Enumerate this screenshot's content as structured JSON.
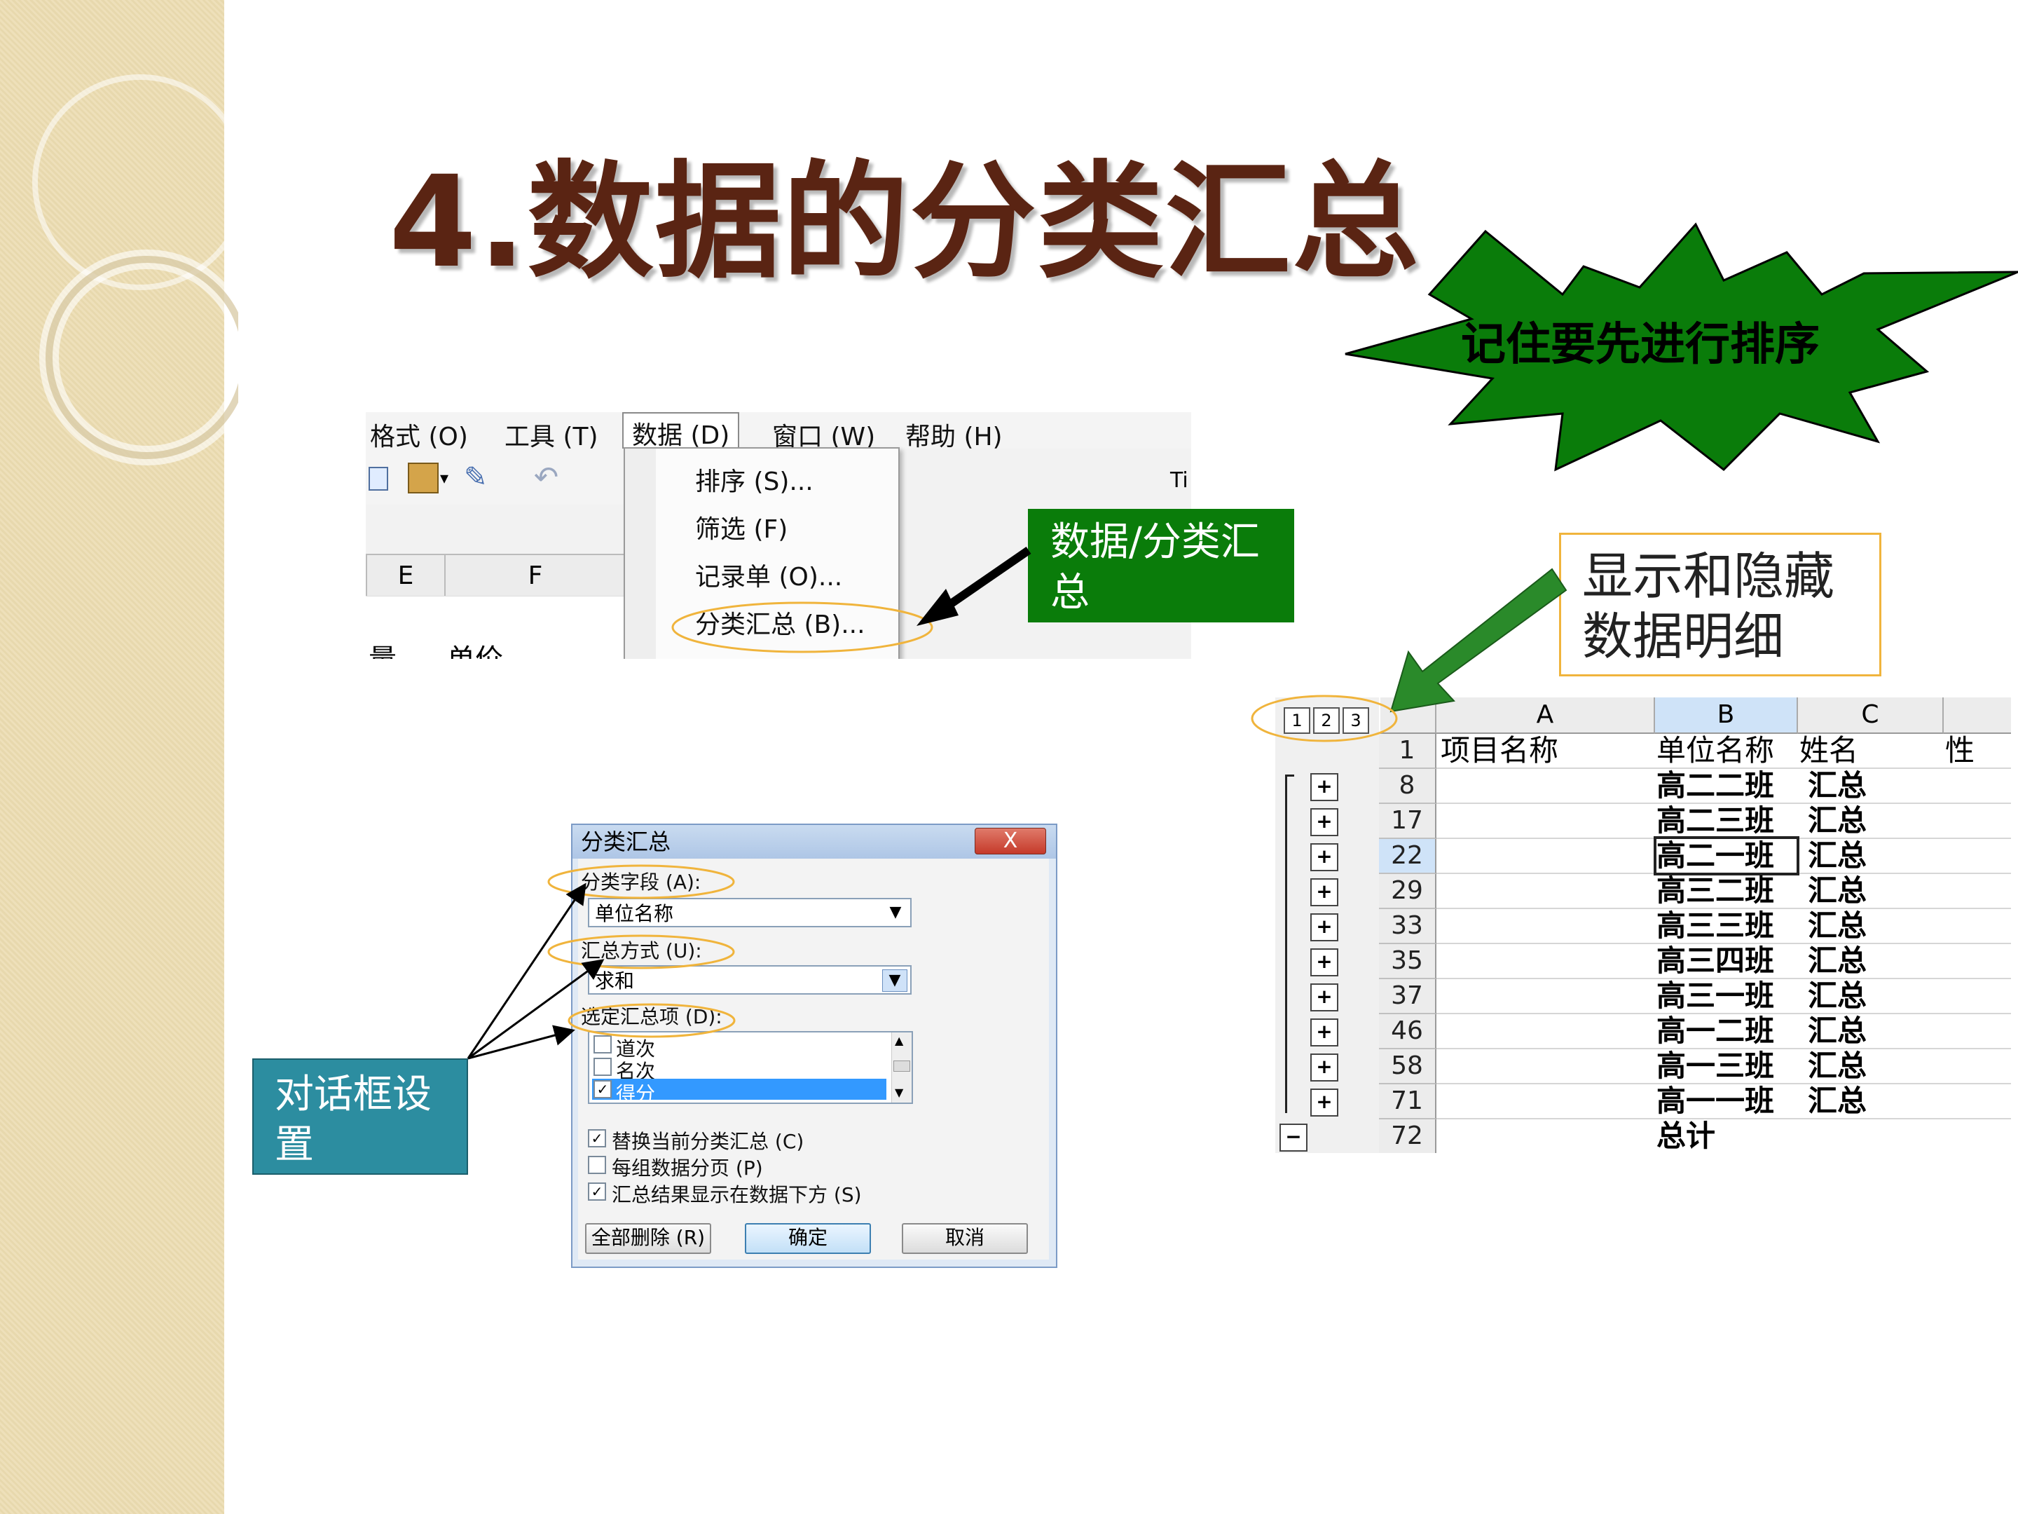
{
  "title": "4.数据的分类汇总",
  "starburst": {
    "text": "记住要先进行排序"
  },
  "menu": {
    "items": [
      "格式 (O)",
      "工具 (T)",
      "数据 (D)",
      "窗口 (W)",
      "帮助 (H)"
    ],
    "dropdown": [
      "排序 (S)...",
      "筛选 (F)",
      "记录单 (O)...",
      "分类汇总 (B)..."
    ],
    "col_e": "E",
    "col_f": "F",
    "cell_a": "量",
    "cell_b": "单价",
    "toolbar_tail": "Ti"
  },
  "green_callout": "数据/分类汇总",
  "orange_callout": "显示和隐藏数据明细",
  "teal_callout": "对话框设置",
  "dialog": {
    "title": "分类汇总",
    "close": "X",
    "field_label": "分类字段 (A):",
    "field_value": "单位名称",
    "method_label": "汇总方式 (U):",
    "method_value": "求和",
    "items_label": "选定汇总项 (D):",
    "list": [
      {
        "label": "道次",
        "checked": false
      },
      {
        "label": "名次",
        "checked": false
      },
      {
        "label": "得分",
        "checked": true
      }
    ],
    "options": [
      {
        "label": "替换当前分类汇总 (C)",
        "checked": true
      },
      {
        "label": "每组数据分页 (P)",
        "checked": false
      },
      {
        "label": "汇总结果显示在数据下方 (S)",
        "checked": true
      }
    ],
    "buttons": {
      "remove": "全部删除 (R)",
      "ok": "确定",
      "cancel": "取消"
    }
  },
  "sheet": {
    "levels": [
      "1",
      "2",
      "3"
    ],
    "columns": [
      "A",
      "B",
      "C"
    ],
    "header_row": {
      "num": "1",
      "a": "项目名称",
      "b": "单位名称",
      "c": "姓名",
      "d": "性"
    },
    "rows": [
      {
        "num": "8",
        "b": "高二二班",
        "c": "汇总"
      },
      {
        "num": "17",
        "b": "高二三班",
        "c": "汇总"
      },
      {
        "num": "22",
        "b": "高二一班",
        "c": "汇总"
      },
      {
        "num": "29",
        "b": "高三二班",
        "c": "汇总"
      },
      {
        "num": "33",
        "b": "高三三班",
        "c": "汇总"
      },
      {
        "num": "35",
        "b": "高三四班",
        "c": "汇总"
      },
      {
        "num": "37",
        "b": "高三一班",
        "c": "汇总"
      },
      {
        "num": "46",
        "b": "高一二班",
        "c": "汇总"
      },
      {
        "num": "58",
        "b": "高一三班",
        "c": "汇总"
      },
      {
        "num": "71",
        "b": "高一一班",
        "c": "汇总"
      },
      {
        "num": "72",
        "b": "总计",
        "c": ""
      }
    ],
    "plus": "+",
    "minus": "−"
  }
}
